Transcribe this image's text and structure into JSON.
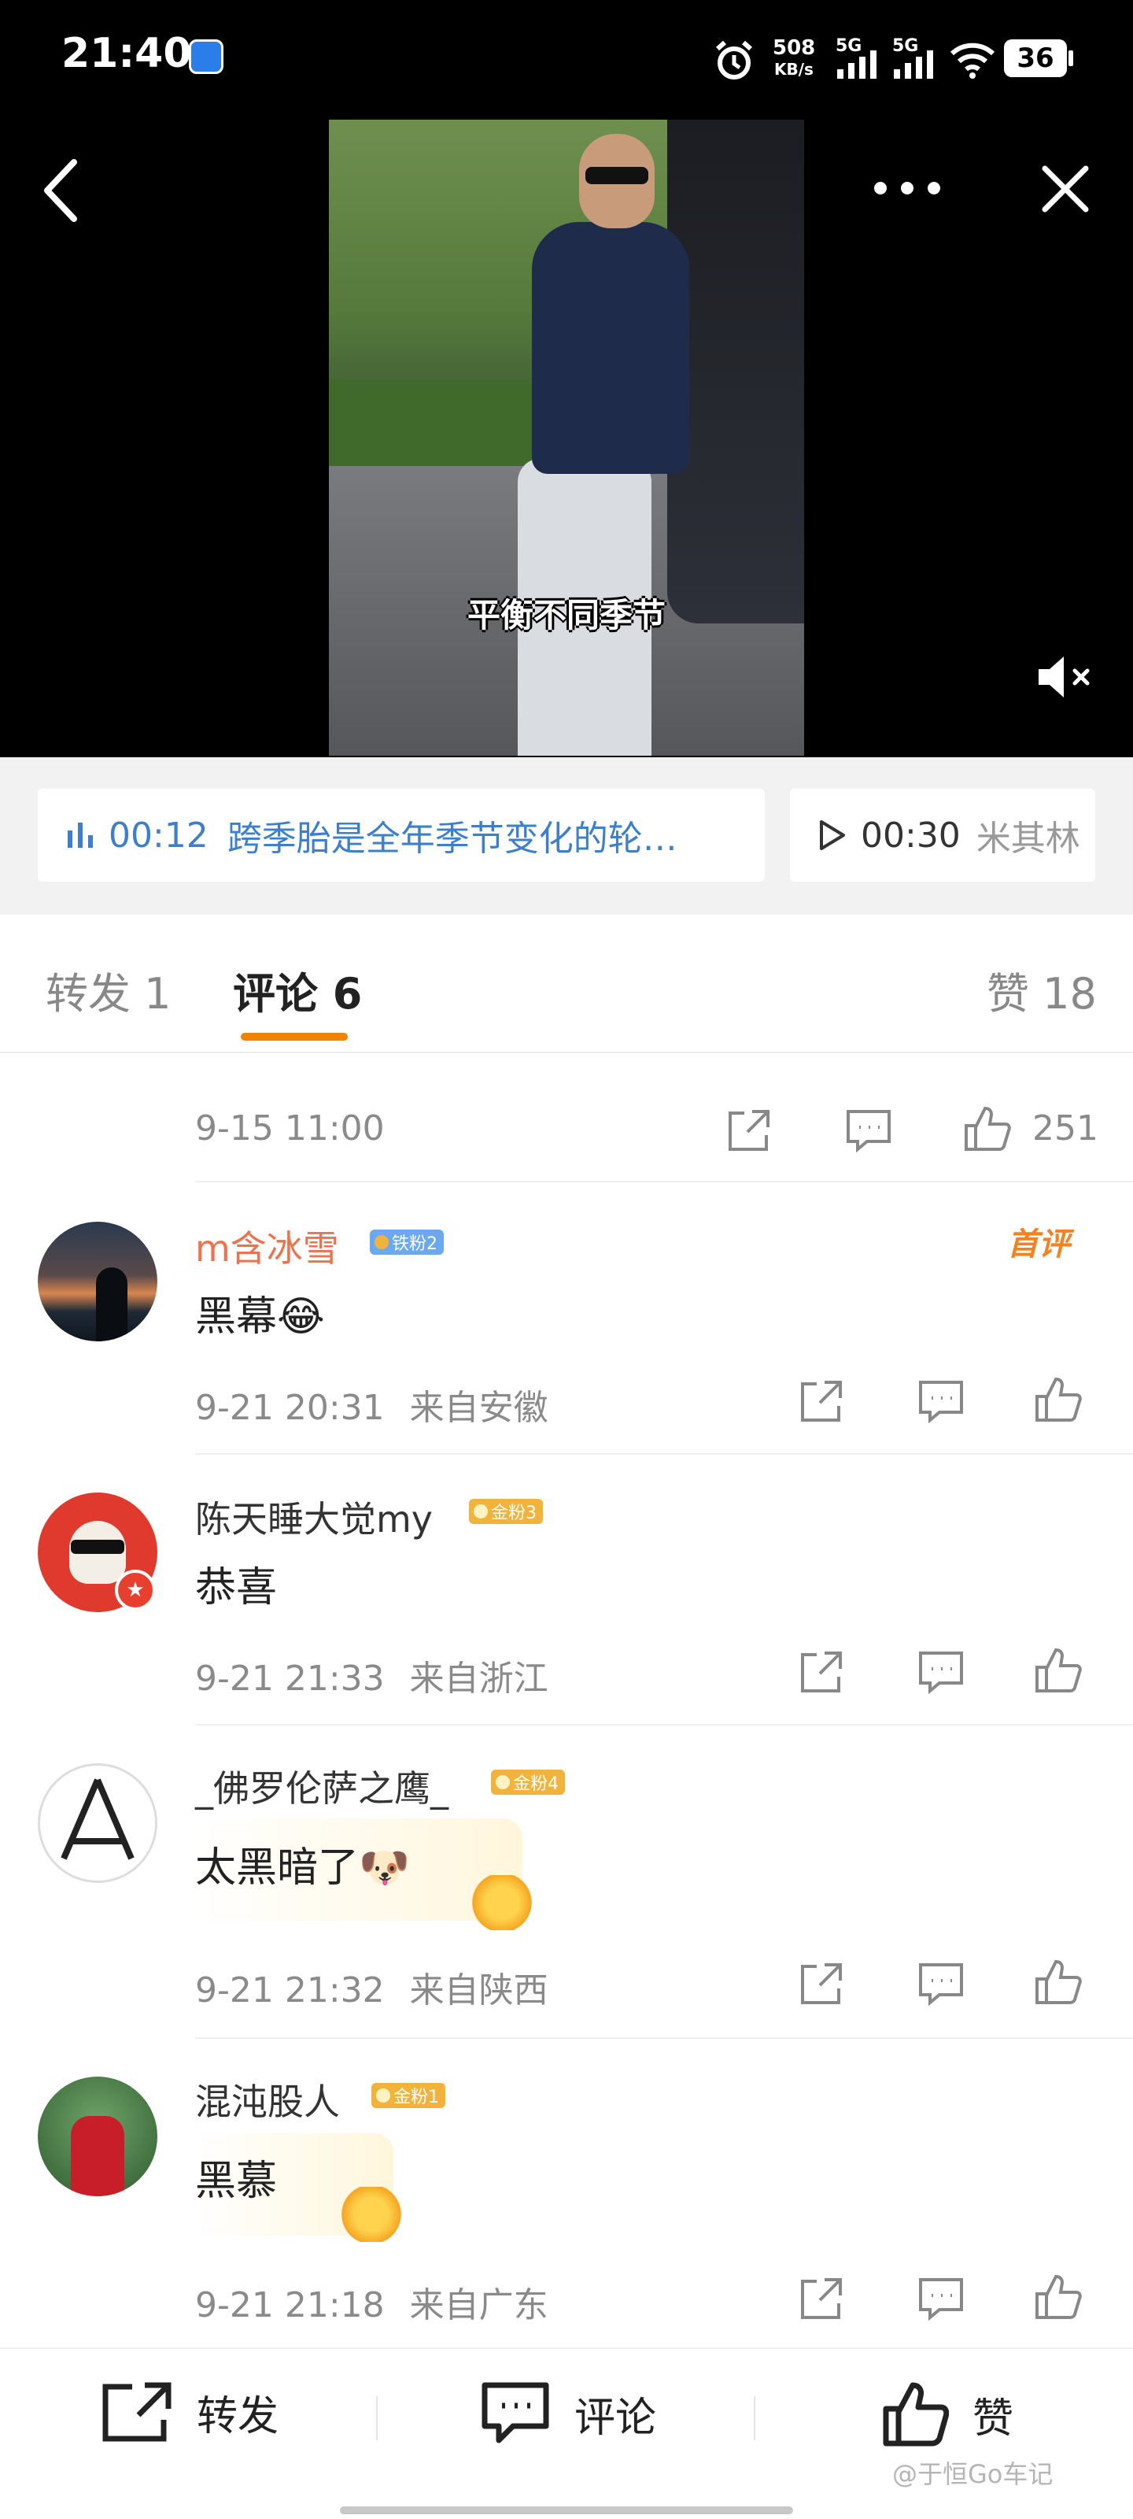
{
  "status_bar": {
    "time": "21:40",
    "net_speed_value": "508",
    "net_speed_unit": "KB/s",
    "sim1": "5G",
    "sim2": "5G",
    "battery": "36"
  },
  "video": {
    "subtitle": "平衡不同季节",
    "muted": true
  },
  "chapters": [
    {
      "time": "00:12",
      "title": "跨季胎是全年季节变化的轮…",
      "active": true
    },
    {
      "time": "00:30",
      "title": "米其林",
      "active": false
    }
  ],
  "tabs": {
    "repost": "转发 1",
    "comment": "评论 6",
    "like": "赞 18"
  },
  "post_meta": {
    "date": "9-15 11:00",
    "likes": "251"
  },
  "comments": [
    {
      "user": "m含冰雪",
      "badge": "铁粉2",
      "text": "黑幕😂",
      "time": "9-21 20:31",
      "location": "来自安徽",
      "first_tag": "首评"
    },
    {
      "user": "陈天睡大觉my",
      "badge": "金粉3",
      "text": "恭喜",
      "time": "9-21 21:33",
      "location": "来自浙江"
    },
    {
      "user": "_佛罗伦萨之鹰_",
      "badge": "金粉4",
      "text": "太黑暗了🐶",
      "time": "9-21 21:32",
      "location": "来自陕西"
    },
    {
      "user": "混沌股人",
      "badge": "金粉1",
      "text": "黑慕",
      "time": "9-21 21:18",
      "location": "来自广东"
    }
  ],
  "bottom_bar": {
    "repost": "转发",
    "comment": "评论",
    "like": "赞"
  },
  "watermark": "@于恒Go车记",
  "colors": {
    "accent_orange": "#f08300",
    "link_blue": "#3d7fcc",
    "badge_blue": "#6aa8f0",
    "badge_gold": "#f2b33d",
    "username_orange": "#eb7350"
  }
}
